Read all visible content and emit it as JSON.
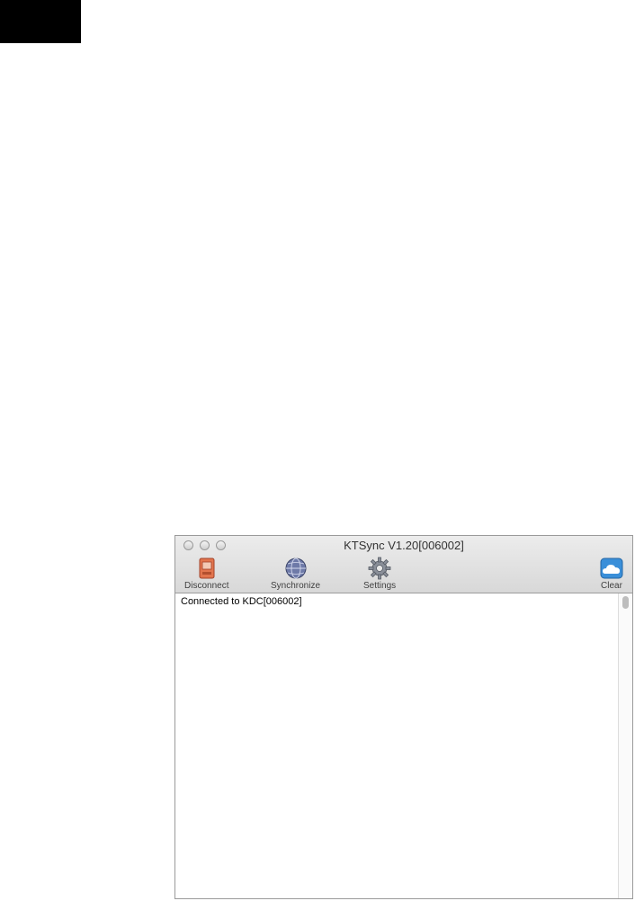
{
  "window": {
    "title": "KTSync V1.20[006002]"
  },
  "toolbar": {
    "disconnect_label": "Disconnect",
    "synchronize_label": "Synchronize",
    "settings_label": "Settings",
    "clear_label": "Clear"
  },
  "log": {
    "lines": [
      "Connected to KDC[006002]"
    ]
  },
  "colors": {
    "disconnect_accent": "#d9623a",
    "clear_accent": "#3a8fd9"
  }
}
